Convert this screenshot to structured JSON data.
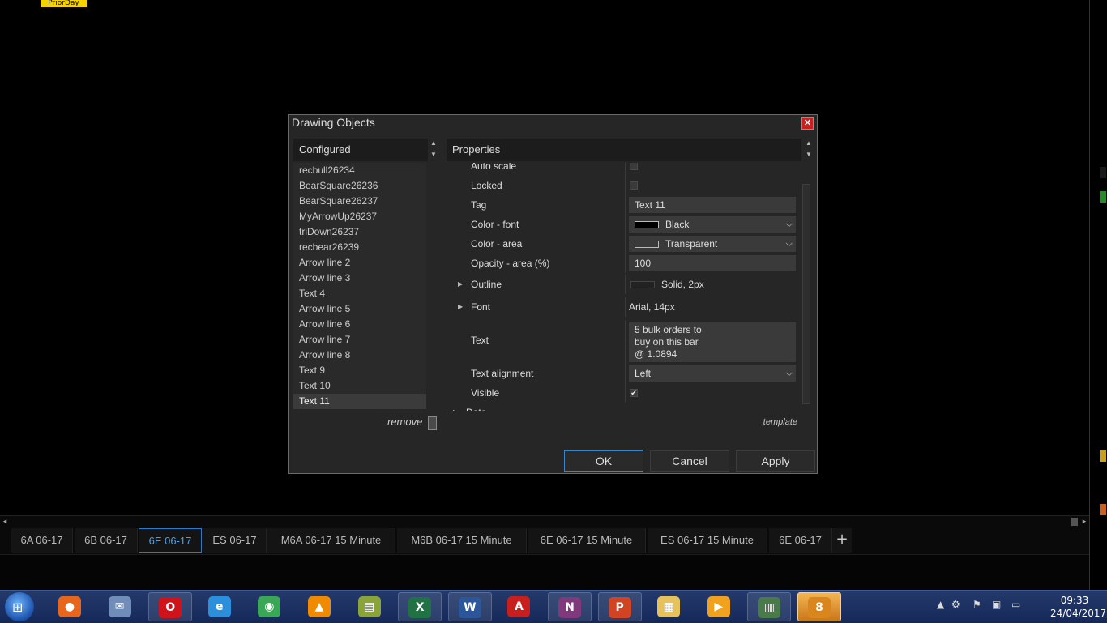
{
  "chart": {
    "prior_day_label": "PriorDay"
  },
  "dialog": {
    "title": "Drawing Objects",
    "configured": {
      "header": "Configured",
      "items": [
        "recbull26234",
        "BearSquare26236",
        "BearSquare26237",
        "MyArrowUp26237",
        "triDown26237",
        "recbear26239",
        "Arrow line 2",
        "Arrow line 3",
        "Text 4",
        "Arrow line 5",
        "Arrow line 6",
        "Arrow line 7",
        "Arrow line 8",
        "Text 9",
        "Text 10",
        "Text 11"
      ],
      "selected": "Text 11",
      "remove_label": "remove"
    },
    "properties": {
      "header": "Properties",
      "auto_scale_label": "Auto scale",
      "locked_label": "Locked",
      "tag_label": "Tag",
      "tag_value": "Text 11",
      "color_font_label": "Color - font",
      "color_font_value": "Black",
      "color_area_label": "Color - area",
      "color_area_value": "Transparent",
      "opacity_label": "Opacity - area (%)",
      "opacity_value": "100",
      "outline_label": "Outline",
      "outline_value": "Solid, 2px",
      "font_label": "Font",
      "font_value": "Arial, 14px",
      "text_label": "Text",
      "text_lines": [
        "5 bulk orders to",
        "buy on this bar",
        "@ 1.0894"
      ],
      "text_alignment_label": "Text alignment",
      "text_alignment_value": "Left",
      "visible_label": "Visible",
      "visible_checked": true,
      "data_label": "Data",
      "template_label": "template"
    },
    "buttons": {
      "ok": "OK",
      "cancel": "Cancel",
      "apply": "Apply"
    }
  },
  "tabs": [
    {
      "label": "6A 06-17",
      "active": false
    },
    {
      "label": "6B 06-17",
      "active": false
    },
    {
      "label": "6E 06-17",
      "active": true
    },
    {
      "label": "ES 06-17",
      "active": false
    },
    {
      "label": "M6A 06-17 15 Minute",
      "active": false
    },
    {
      "label": "M6B 06-17 15 Minute",
      "active": false
    },
    {
      "label": "6E 06-17 15 Minute",
      "active": false
    },
    {
      "label": "ES 06-17 15 Minute",
      "active": false
    },
    {
      "label": "6E 06-17",
      "active": false
    }
  ],
  "taskbar": {
    "apps": [
      {
        "name": "firefox-icon",
        "color": "#e8661b"
      },
      {
        "name": "mail-icon",
        "color": "#6f8db8"
      },
      {
        "name": "opera-icon",
        "color": "#d0131b"
      },
      {
        "name": "internet-explorer-icon",
        "color": "#2c8fdc"
      },
      {
        "name": "chrome-icon",
        "color": "#3aa757"
      },
      {
        "name": "vlc-icon",
        "color": "#f08a00"
      },
      {
        "name": "chart-app-icon",
        "color": "#8aa43a"
      },
      {
        "name": "excel-icon",
        "color": "#207245"
      },
      {
        "name": "word-icon",
        "color": "#2b579a"
      },
      {
        "name": "acrobat-icon",
        "color": "#c81e1e"
      },
      {
        "name": "onenote-icon",
        "color": "#80397b"
      },
      {
        "name": "powerpoint-icon",
        "color": "#d04423"
      },
      {
        "name": "file-explorer-icon",
        "color": "#e6c25a"
      },
      {
        "name": "media-player-icon",
        "color": "#f0a11e"
      },
      {
        "name": "terminal-monitor-icon",
        "color": "#4a7a4a"
      },
      {
        "name": "ninjatrader-icon",
        "color": "#d9861f"
      }
    ],
    "clock_time": "09:33",
    "clock_date": "24/04/2017"
  }
}
